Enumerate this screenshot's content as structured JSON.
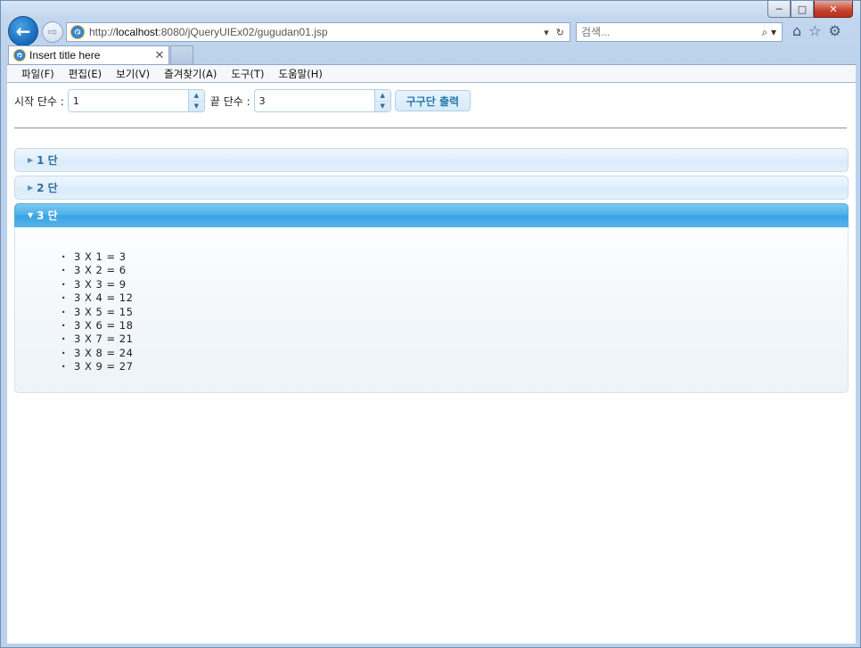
{
  "browser": {
    "url_prefix": "http://",
    "url_host": "localhost",
    "url_rest": ":8080/jQueryUIEx02/gugudan01.jsp",
    "search_placeholder": "검색...",
    "tab_title": "Insert title here",
    "window_buttons": {
      "minimize": "─",
      "maximize": "□",
      "close": "✕"
    },
    "icons": [
      "back-arrow-icon",
      "forward-arrow-icon",
      "ie-logo-icon",
      "dropdown-icon",
      "refresh-icon",
      "search-icon",
      "home-icon",
      "favorites-star-icon",
      "settings-gear-icon"
    ]
  },
  "menu": [
    "파일(F)",
    "편집(E)",
    "보기(V)",
    "즐겨찾기(A)",
    "도구(T)",
    "도움말(H)"
  ],
  "form": {
    "start_label": "시작 단수 :",
    "start_value": "1",
    "end_label": "끝 단수 :",
    "end_value": "3",
    "print_button": "구구단 출력"
  },
  "accordion": {
    "sections": [
      {
        "label": "1 단",
        "active": false
      },
      {
        "label": "2 단",
        "active": false
      },
      {
        "label": "3 단",
        "active": true
      }
    ],
    "active_items": [
      "3 X 1 = 3",
      "3 X 2 = 6",
      "3 X 3 = 9",
      "3 X 4 = 12",
      "3 X 5 = 15",
      "3 X 6 = 18",
      "3 X 7 = 21",
      "3 X 8 = 24",
      "3 X 9 = 27"
    ]
  },
  "colors": {
    "accent": "#2e6e9e",
    "active_header": "#3aa3e3",
    "header_border": "#c5dbec"
  }
}
